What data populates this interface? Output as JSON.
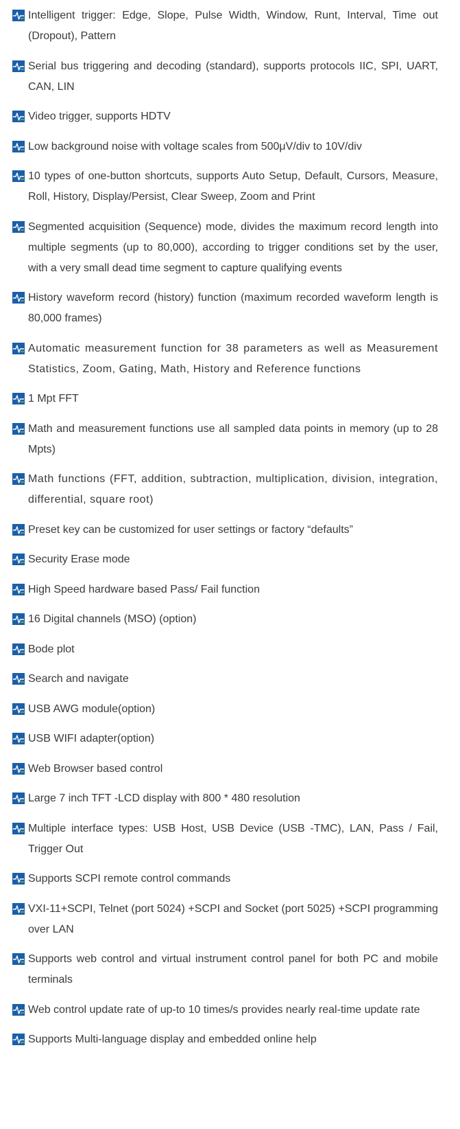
{
  "colors": {
    "text": "#3a3a3a",
    "bullet_fill": "#1a5fa8",
    "bullet_wave": "#ffffff",
    "bullet_accent": "#8bc34a"
  },
  "bullet_icon": "oscilloscope-wave-icon",
  "features": [
    "Intelligent trigger: Edge, Slope, Pulse Width, Window, Runt, Interval, Time out (Dropout), Pattern",
    "Serial bus triggering and decoding (standard), supports protocols IIC, SPI, UART, CAN, LIN",
    "Video trigger, supports HDTV",
    "Low background noise with voltage scales from 500μV/div to 10V/div",
    "10 types of one-button shortcuts, supports Auto Setup, Default, Cursors, Measure, Roll, History, Display/Persist, Clear Sweep, Zoom and Print",
    "Segmented acquisition (Sequence) mode, divides the maximum record length into multiple segments (up to 80,000), according to trigger conditions set by the user, with a very small dead time segment to capture qualifying events",
    "History waveform record (history) function (maximum recorded waveform length is 80,000 frames)",
    "Automatic measurement function for 38 parameters as well as Measurement Statistics, Zoom, Gating, Math, History and Reference functions",
    "1 Mpt FFT",
    "Math and measurement functions use all sampled data points in memory (up to 28 Mpts)",
    "Math functions (FFT, addition, subtraction, multiplication, division, integration, differential, square root)",
    "Preset key can be customized for user settings or factory “defaults”",
    "Security Erase mode",
    "High Speed hardware based Pass/ Fail function",
    "16 Digital channels (MSO) (option)",
    "Bode plot",
    "Search and navigate",
    "USB AWG module(option)",
    "USB WIFI adapter(option)",
    "Web Browser based control",
    "Large 7 inch TFT -LCD display with 800 * 480 resolution",
    "Multiple interface types: USB Host, USB Device (USB -TMC), LAN, Pass / Fail, Trigger Out",
    "Supports SCPI remote control commands",
    "VXI-11+SCPI, Telnet (port 5024) +SCPI and Socket (port 5025) +SCPI programming over LAN",
    "Supports web control and virtual instrument control panel for both PC and mobile terminals",
    "Web control update rate of up-to 10 times/s provides nearly real-time update rate",
    "Supports Multi-language display and embedded online help"
  ]
}
